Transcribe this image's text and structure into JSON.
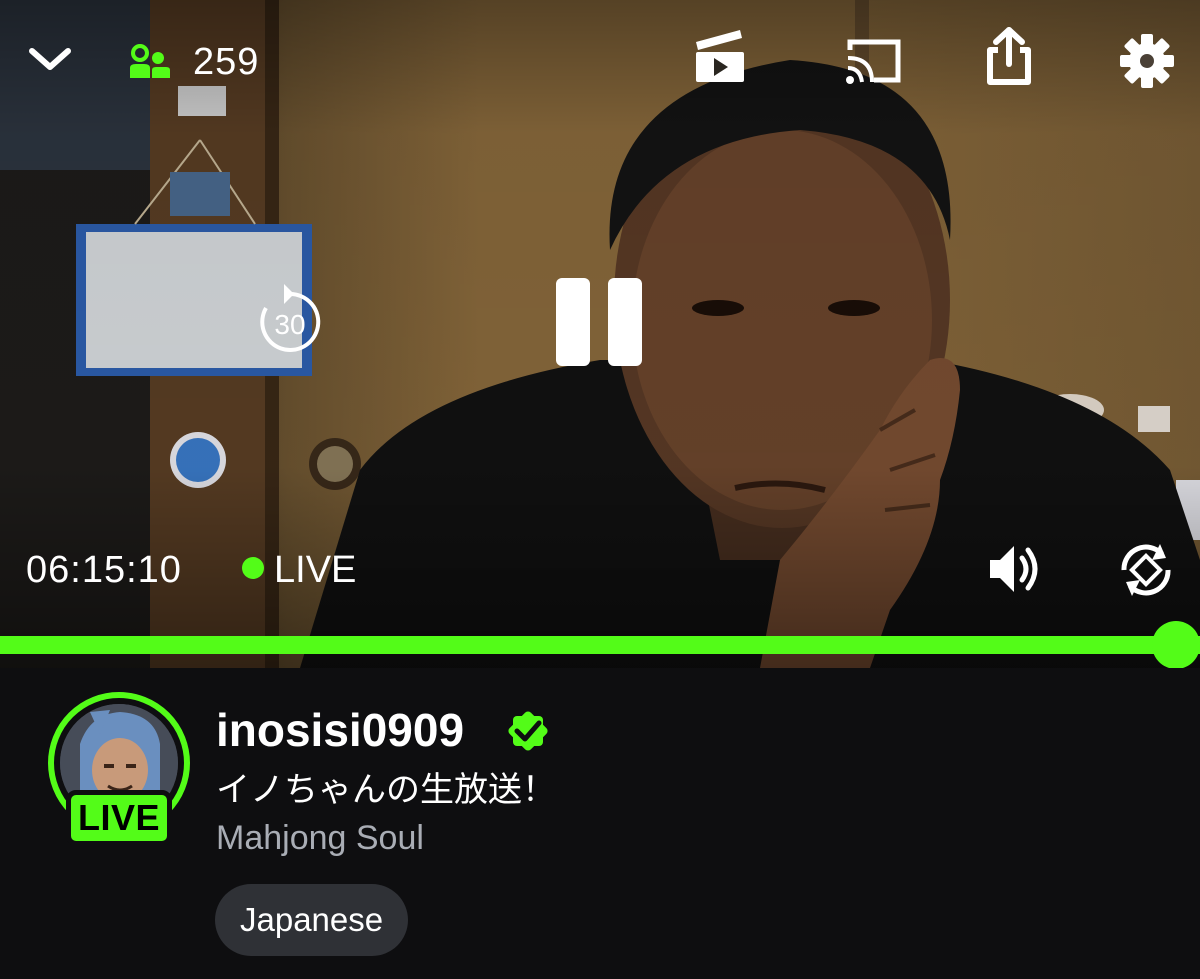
{
  "header": {
    "collapse_icon": "chevron-down-icon",
    "viewers_icon": "viewers-icon",
    "viewer_count": "259",
    "clip_icon": "clip-icon",
    "cast_icon": "cast-icon",
    "share_icon": "share-icon",
    "settings_icon": "gear-icon"
  },
  "player": {
    "rewind_label": "30",
    "pause_icon": "pause-icon",
    "timecode": "06:15:10",
    "live_label": "LIVE",
    "volume_icon": "volume-icon",
    "rotate_icon": "rotate-icon",
    "progress": 1.0
  },
  "channel": {
    "live_badge": "LIVE",
    "name": "inosisi0909",
    "verified_icon": "verified-badge-icon",
    "stream_title": "イノちゃんの生放送！",
    "category": "Mahjong Soul",
    "tags": [
      "Japanese"
    ]
  },
  "colors": {
    "accent": "#53fc18",
    "background": "#0e0e10",
    "tag_background": "#2f3136",
    "category_text": "#a9adb5"
  }
}
